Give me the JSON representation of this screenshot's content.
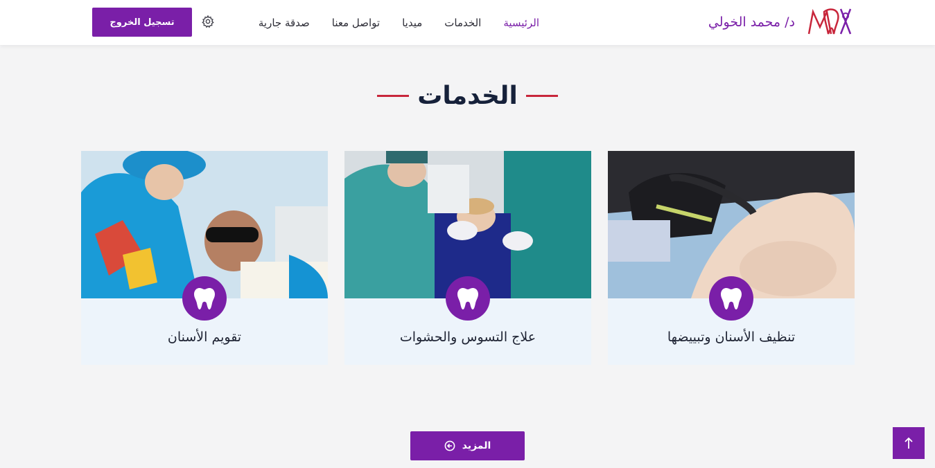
{
  "header": {
    "brand_name": "د/ محمد الخولي",
    "logo_icon": "tooth-logo-icon",
    "nav": [
      {
        "label": "الرئيسية",
        "active": true
      },
      {
        "label": "الخدمات",
        "active": false
      },
      {
        "label": "ميديا",
        "active": false
      },
      {
        "label": "تواصل معنا",
        "active": false
      },
      {
        "label": "صدقة جارية",
        "active": false
      }
    ],
    "settings_icon": "gear-icon",
    "logout_label": "تسجيل الخروج"
  },
  "services": {
    "title": "الخدمات",
    "cards": [
      {
        "title": "تنظيف الأسنان وتبييضها",
        "icon": "tooth-icon"
      },
      {
        "title": "علاج التسوس والحشوات",
        "icon": "tooth-icon"
      },
      {
        "title": "تقويم الأسنان",
        "icon": "tooth-icon"
      }
    ],
    "more_label": "المزيد"
  },
  "scroll_top_icon": "arrow-up-icon",
  "colors": {
    "accent": "#7a1fa8",
    "title_line": "#c8263b",
    "card_bg": "#edf4fb",
    "page_bg": "#f4f4f5"
  }
}
